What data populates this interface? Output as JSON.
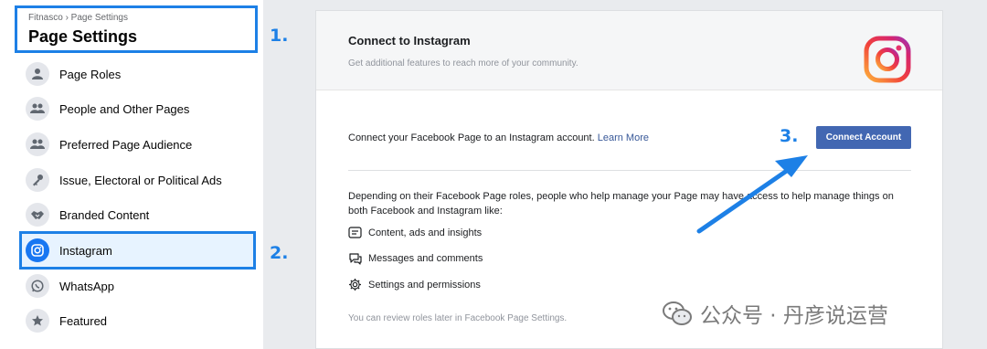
{
  "sidebar": {
    "breadcrumb": "Fitnasco › Page Settings",
    "title": "Page Settings",
    "items": [
      {
        "label": "Page Roles",
        "icon": "person-icon"
      },
      {
        "label": "People and Other Pages",
        "icon": "people-icon"
      },
      {
        "label": "Preferred Page Audience",
        "icon": "people-icon"
      },
      {
        "label": "Issue, Electoral or Political Ads",
        "icon": "key-icon"
      },
      {
        "label": "Branded Content",
        "icon": "handshake-icon"
      },
      {
        "label": "Instagram",
        "icon": "instagram-icon",
        "active": true
      },
      {
        "label": "WhatsApp",
        "icon": "whatsapp-icon"
      },
      {
        "label": "Featured",
        "icon": "star-icon"
      }
    ]
  },
  "steps": {
    "one": "1.",
    "two": "2.",
    "three": "3."
  },
  "card": {
    "title": "Connect to Instagram",
    "subtitle": "Get additional features to reach more of your community.",
    "connect_text": "Connect your Facebook Page to an Instagram account.",
    "learn_more": "Learn More",
    "connect_button": "Connect Account",
    "description": "Depending on their Facebook Page roles, people who help manage your Page may have access to help manage things on both Facebook and Instagram like:",
    "features": [
      "Content, ads and insights",
      "Messages and comments",
      "Settings and permissions"
    ],
    "review_note": "You can review roles later in Facebook Page Settings."
  },
  "watermark": "公众号 · 丹彦说运营",
  "colors": {
    "accent": "#1d80e6",
    "button": "#4267b2",
    "active_bg": "#e7f3ff"
  }
}
